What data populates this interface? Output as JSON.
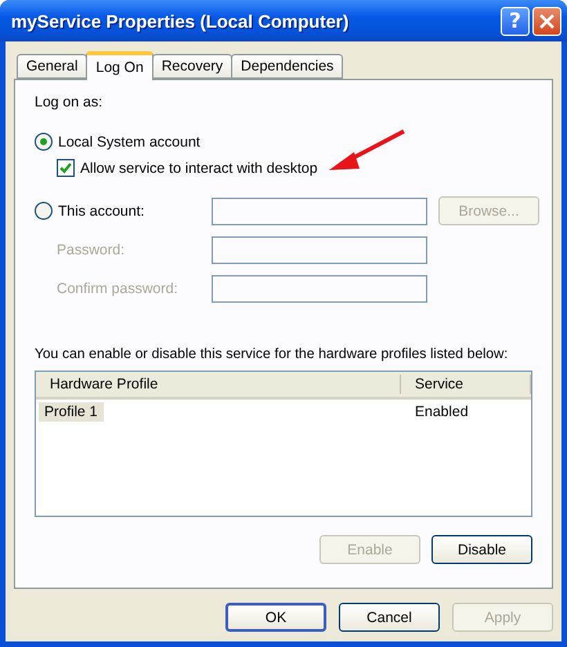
{
  "window": {
    "title": "myService Properties (Local Computer)",
    "help": "?"
  },
  "tabs": [
    {
      "label": "General",
      "selected": false
    },
    {
      "label": "Log On",
      "selected": true
    },
    {
      "label": "Recovery",
      "selected": false
    },
    {
      "label": "Dependencies",
      "selected": false
    }
  ],
  "log_on_as": {
    "label": "Log on as:",
    "accounts": [
      {
        "label": "Local System account",
        "selected": true
      },
      {
        "label": "This account:",
        "selected": false
      }
    ],
    "interact": {
      "label": "Allow service to interact with desktop",
      "checked": true
    },
    "browse": {
      "label": "Browse...",
      "disabled": true
    },
    "password_fields": [
      {
        "label": "Password:",
        "disabled": true
      },
      {
        "label": "Confirm password:",
        "disabled": true
      }
    ]
  },
  "profiles": {
    "hint": "You can enable or disable this service for the hardware profiles listed below:",
    "columns": [
      "Hardware Profile",
      "Service"
    ],
    "rows": [
      {
        "cells": [
          "Profile 1",
          "Enabled"
        ],
        "selected": true
      }
    ],
    "buttons": [
      {
        "label": "Enable",
        "disabled": true
      },
      {
        "label": "Disable",
        "disabled": false
      }
    ]
  },
  "buttons": [
    {
      "label": "OK",
      "disabled": false,
      "default": true
    },
    {
      "label": "Cancel",
      "disabled": false,
      "default": false
    },
    {
      "label": "Apply",
      "disabled": true,
      "default": false
    }
  ]
}
